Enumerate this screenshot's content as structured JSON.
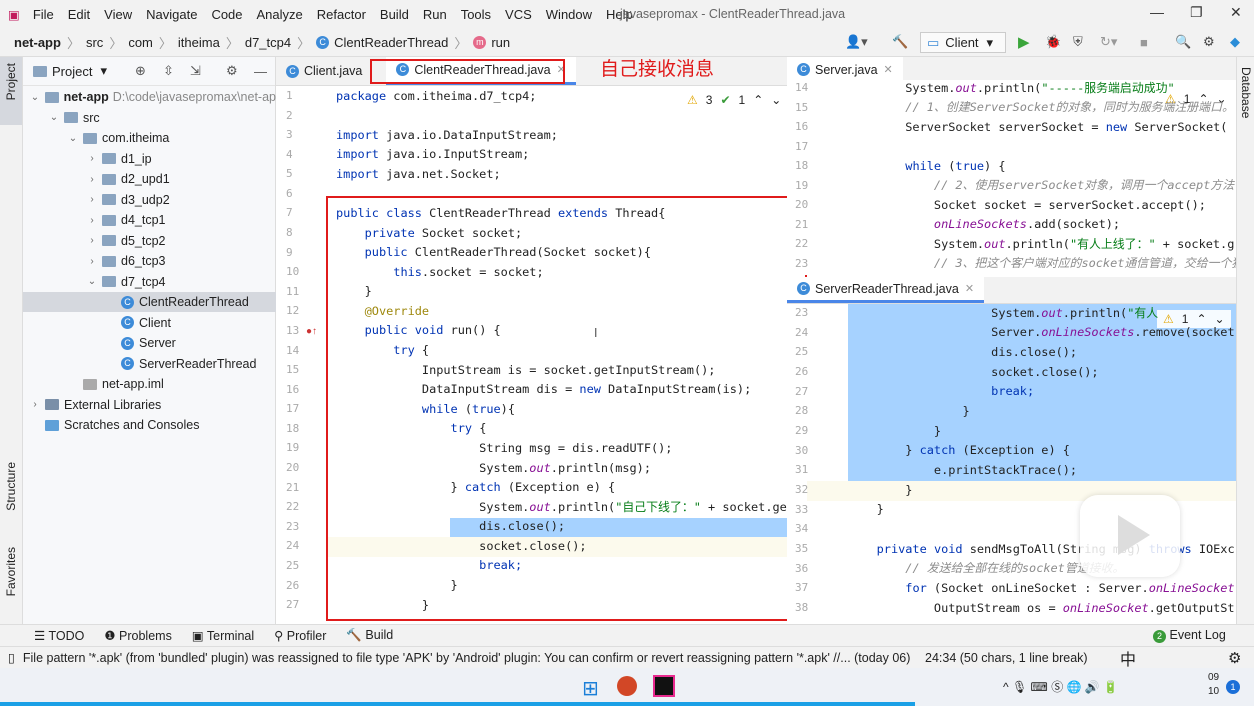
{
  "menu": {
    "items": [
      "File",
      "Edit",
      "View",
      "Navigate",
      "Code",
      "Analyze",
      "Refactor",
      "Build",
      "Run",
      "Tools",
      "VCS",
      "Window",
      "Help"
    ],
    "window_title": "javasepromax - ClentReaderThread.java"
  },
  "nav": {
    "crumbs": [
      "net-app",
      "src",
      "com",
      "itheima",
      "d7_tcp4",
      "ClentReaderThread",
      "run"
    ],
    "run_config": "Client"
  },
  "project": {
    "header": "Project",
    "tree": [
      {
        "label": "net-app",
        "extra": "D:\\code\\javasepromax\\net-ap",
        "depth": 0,
        "arrow": "v",
        "icon": "module"
      },
      {
        "label": "src",
        "depth": 1,
        "arrow": "v",
        "icon": "folder"
      },
      {
        "label": "com.itheima",
        "depth": 2,
        "arrow": "v",
        "icon": "package"
      },
      {
        "label": "d1_ip",
        "depth": 3,
        "arrow": ">",
        "icon": "package"
      },
      {
        "label": "d2_upd1",
        "depth": 3,
        "arrow": ">",
        "icon": "package"
      },
      {
        "label": "d3_udp2",
        "depth": 3,
        "arrow": ">",
        "icon": "package"
      },
      {
        "label": "d4_tcp1",
        "depth": 3,
        "arrow": ">",
        "icon": "package"
      },
      {
        "label": "d5_tcp2",
        "depth": 3,
        "arrow": ">",
        "icon": "package"
      },
      {
        "label": "d6_tcp3",
        "depth": 3,
        "arrow": ">",
        "icon": "package"
      },
      {
        "label": "d7_tcp4",
        "depth": 3,
        "arrow": "v",
        "icon": "package"
      },
      {
        "label": "ClentReaderThread",
        "depth": 4,
        "arrow": "",
        "icon": "class",
        "selected": true
      },
      {
        "label": "Client",
        "depth": 4,
        "arrow": "",
        "icon": "class"
      },
      {
        "label": "Server",
        "depth": 4,
        "arrow": "",
        "icon": "class"
      },
      {
        "label": "ServerReaderThread",
        "depth": 4,
        "arrow": "",
        "icon": "class"
      },
      {
        "label": "net-app.iml",
        "depth": 2,
        "arrow": "",
        "icon": "file"
      },
      {
        "label": "External Libraries",
        "depth": 0,
        "arrow": ">",
        "icon": "library"
      },
      {
        "label": "Scratches and Consoles",
        "depth": 0,
        "arrow": "",
        "icon": "scratch"
      }
    ]
  },
  "left_strip": {
    "project": "Project",
    "structure": "Structure",
    "favorites": "Favorites"
  },
  "right_strip": {
    "database": "Database"
  },
  "editor_left": {
    "tabs": [
      "Client.java",
      "ClentReaderThread.java"
    ],
    "active_tab": 1,
    "warnings": "3",
    "checks": "1",
    "first_line": 1,
    "lines": [
      "package com.itheima.d7_tcp4;",
      "",
      "import java.io.DataInputStream;",
      "import java.io.InputStream;",
      "import java.net.Socket;",
      "",
      "public class ClentReaderThread extends Thread{",
      "    private Socket socket;",
      "    public ClentReaderThread(Socket socket){",
      "        this.socket = socket;",
      "    }",
      "    @Override",
      "    public void run() {",
      "        try {",
      "            InputStream is = socket.getInputStream();",
      "            DataInputStream dis = new DataInputStream(is);",
      "            while (true){",
      "                try {",
      "                    String msg = dis.readUTF();",
      "                    System.out.println(msg);",
      "                } catch (Exception e) {",
      "                    System.out.println(\"自己下线了：\" + socket.ge",
      "                    dis.close();",
      "                    socket.close();",
      "                    break;",
      "                }",
      "            }"
    ]
  },
  "annotation": "自己接收消息",
  "editor_right_top": {
    "tab": "Server.java",
    "warnings": "1",
    "first_line": 14,
    "lines": [
      "        System.out.println(\"-----服务端启动成功\"",
      "        // 1、创建ServerSocket的对象，同时为服务端注册端口。",
      "        ServerSocket serverSocket = new ServerSocket(",
      "",
      "        while (true) {",
      "            // 2、使用serverSocket对象，调用一个accept方法",
      "            Socket socket = serverSocket.accept();",
      "            onLineSockets.add(socket);",
      "            System.out.println(\"有人上线了：\" + socket.g",
      "            // 3、把这个客户端对应的socket通信管道，交给一个独"
    ]
  },
  "editor_right_bottom": {
    "tab": "ServerReaderThread.java",
    "warnings": "1",
    "first_line": 23,
    "lines": [
      "                    System.out.println(\"有人",
      "                    Server.onLineSockets.remove(socket",
      "                    dis.close();",
      "                    socket.close();",
      "                    break;",
      "                }",
      "            }",
      "        } catch (Exception e) {",
      "            e.printStackTrace();",
      "        }",
      "    }",
      "",
      "    private void sendMsgToAll(String msg) throws IOExc",
      "        // 发送给全部在线的socket管道接收。",
      "        for (Socket onLineSocket : Server.onLineSocket",
      "            OutputStream os = onLineSocket.getOutputSt"
    ]
  },
  "tool_windows": [
    "TODO",
    "Problems",
    "Terminal",
    "Profiler",
    "Build"
  ],
  "event_log": {
    "count": "2",
    "label": "Event Log"
  },
  "status": {
    "message": "File pattern '*.apk' (from 'bundled' plugin) was reassigned to file type 'APK' by 'Android' plugin: You can confirm or revert reassigning pattern '*.apk' //... (today 06)",
    "position": "24:34 (50 chars, 1 line break)"
  },
  "taskbar": {
    "ime": "中",
    "clock": [
      "09",
      "10"
    ],
    "notifications": "1"
  },
  "video_progress": 0.73,
  "colors": {
    "accent": "#4a86e8",
    "selection": "#a6d2ff",
    "annotation": "#e01b1b"
  }
}
